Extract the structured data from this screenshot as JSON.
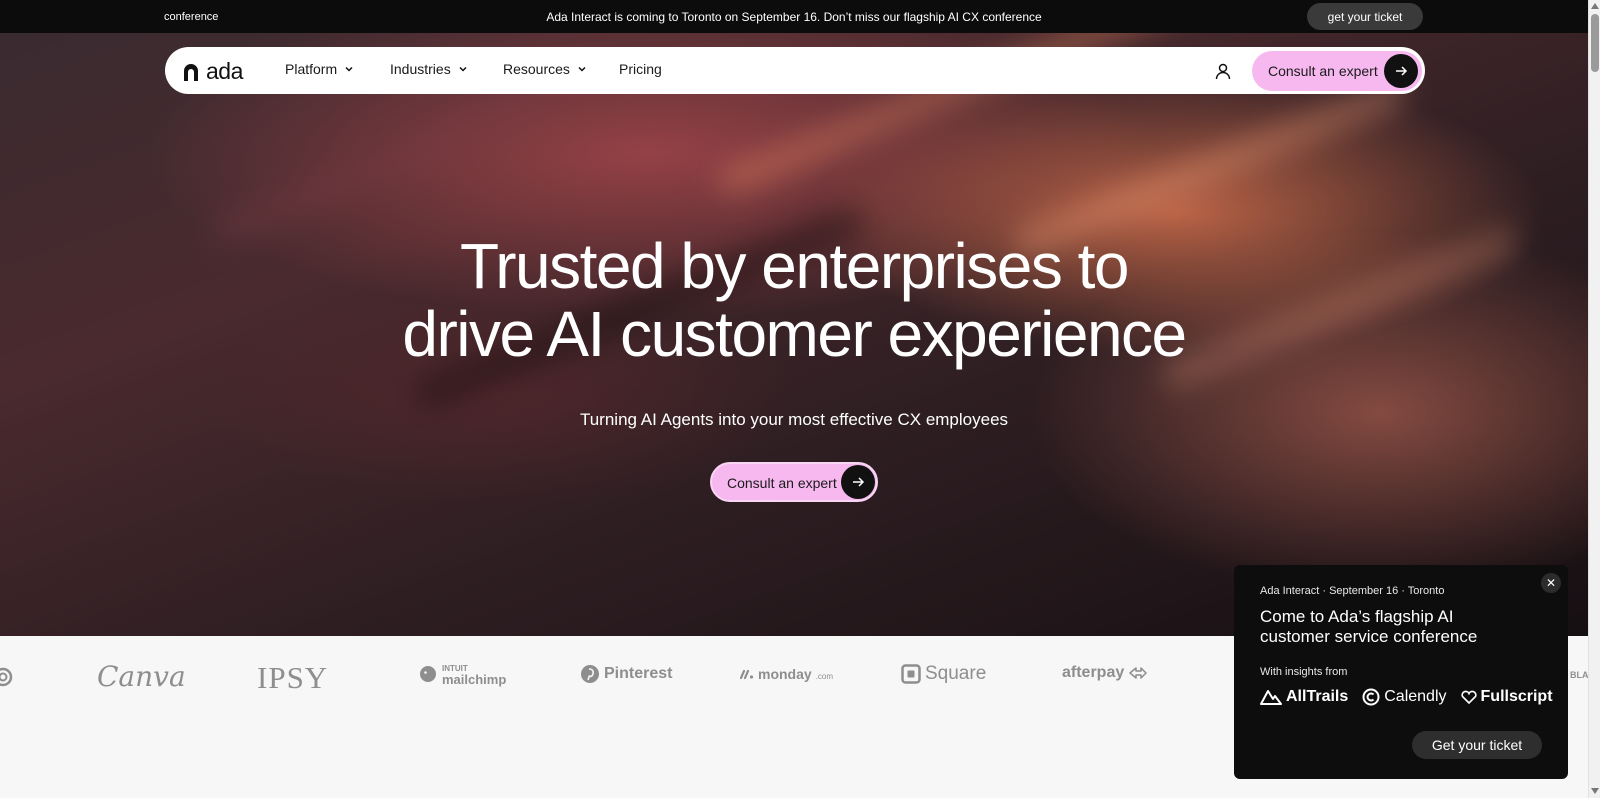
{
  "topbar": {
    "left_text": "conference",
    "announcement": "Ada Interact is coming to Toronto on September 16. Don’t miss our flagship AI CX conference",
    "ticket_label": "get your ticket"
  },
  "nav": {
    "logo_text": "ada",
    "items": [
      {
        "label": "Platform",
        "has_dropdown": true
      },
      {
        "label": "Industries",
        "has_dropdown": true
      },
      {
        "label": "Resources",
        "has_dropdown": true
      },
      {
        "label": "Pricing",
        "has_dropdown": false
      }
    ],
    "user_icon": "user-icon",
    "cta_label": "Consult an expert"
  },
  "hero": {
    "title_line1": "Trusted by enterprises to",
    "title_line2": "drive AI customer experience",
    "subtitle": "Turning AI Agents into your most effective CX employees",
    "cta_label": "Consult an expert"
  },
  "logos": [
    "Canva",
    "IPSY",
    "mailchimp",
    "Pinterest",
    "monday",
    "Square",
    "afterpay"
  ],
  "logos_extra": {
    "mailchimp_prefix": "INTUIT",
    "monday_suffix": ".com",
    "partial_right": "BLA"
  },
  "popup": {
    "eyebrow": "Ada Interact · September 16 · Toronto",
    "headline": "Come to Ada’s flagship AI customer service conference",
    "insights_label": "With insights from",
    "partners": [
      "AllTrails",
      "Calendly",
      "Fullscript"
    ],
    "button_label": "Get your ticket",
    "close_symbol": "✕"
  },
  "colors": {
    "accent_pink": "#f6b8ef",
    "dark": "#0d0d0d",
    "logo_gray": "#8e8e8e"
  }
}
